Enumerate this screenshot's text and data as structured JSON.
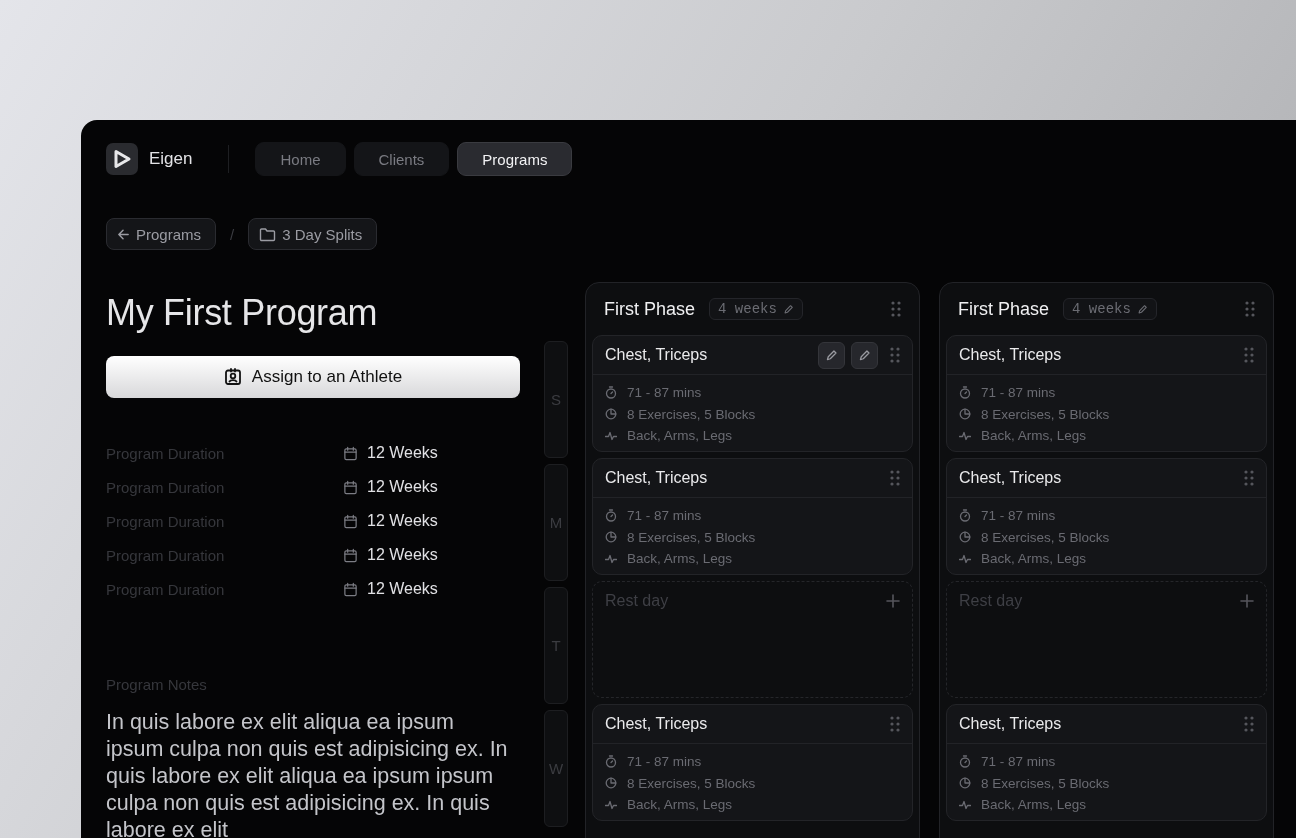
{
  "brand": {
    "name": "Eigen"
  },
  "nav": [
    {
      "label": "Home",
      "selected": false
    },
    {
      "label": "Clients",
      "selected": false
    },
    {
      "label": "Programs",
      "selected": true
    }
  ],
  "breadcrumb": {
    "back": "Programs",
    "separator": "/",
    "folder": "3 Day Splits"
  },
  "program": {
    "title": "My First Program",
    "assign_button": "Assign to an Athlete",
    "details": [
      {
        "label": "Program Duration",
        "value": "12 Weeks"
      },
      {
        "label": "Program Duration",
        "value": "12 Weeks"
      },
      {
        "label": "Program Duration",
        "value": "12 Weeks"
      },
      {
        "label": "Program Duration",
        "value": "12 Weeks"
      },
      {
        "label": "Program Duration",
        "value": "12 Weeks"
      }
    ],
    "notes_label": "Program Notes",
    "notes": "In quis labore ex elit aliqua ea ipsum ipsum culpa non quis est adipisicing ex. In quis labore ex elit aliqua ea ipsum ipsum culpa non quis est adipisicing ex. In quis labore ex elit"
  },
  "days": [
    "S",
    "M",
    "T",
    "W"
  ],
  "phases": [
    {
      "title": "First Phase",
      "weeks": "4 weeks",
      "workouts": [
        {
          "kind": "workout",
          "title": "Chest, Triceps",
          "duration": "71 - 87 mins",
          "content": "8 Exercises, 5 Blocks",
          "muscles": "Back, Arms, Legs",
          "hovered": true
        },
        {
          "kind": "workout",
          "title": "Chest, Triceps",
          "duration": "71 - 87 mins",
          "content": "8 Exercises, 5 Blocks",
          "muscles": "Back, Arms, Legs",
          "hovered": false
        },
        {
          "kind": "rest",
          "title": "Rest day"
        },
        {
          "kind": "workout",
          "title": "Chest, Triceps",
          "duration": "71 - 87 mins",
          "content": "8 Exercises, 5 Blocks",
          "muscles": "Back, Arms, Legs",
          "hovered": false
        }
      ]
    },
    {
      "title": "First Phase",
      "weeks": "4 weeks",
      "workouts": [
        {
          "kind": "workout",
          "title": "Chest, Triceps",
          "duration": "71 - 87 mins",
          "content": "8 Exercises, 5 Blocks",
          "muscles": "Back, Arms, Legs",
          "hovered": false
        },
        {
          "kind": "workout",
          "title": "Chest, Triceps",
          "duration": "71 - 87 mins",
          "content": "8 Exercises, 5 Blocks",
          "muscles": "Back, Arms, Legs",
          "hovered": false
        },
        {
          "kind": "rest",
          "title": "Rest day"
        },
        {
          "kind": "workout",
          "title": "Chest, Triceps",
          "duration": "71 - 87 mins",
          "content": "8 Exercises, 5 Blocks",
          "muscles": "Back, Arms, Legs",
          "hovered": false
        }
      ]
    }
  ]
}
